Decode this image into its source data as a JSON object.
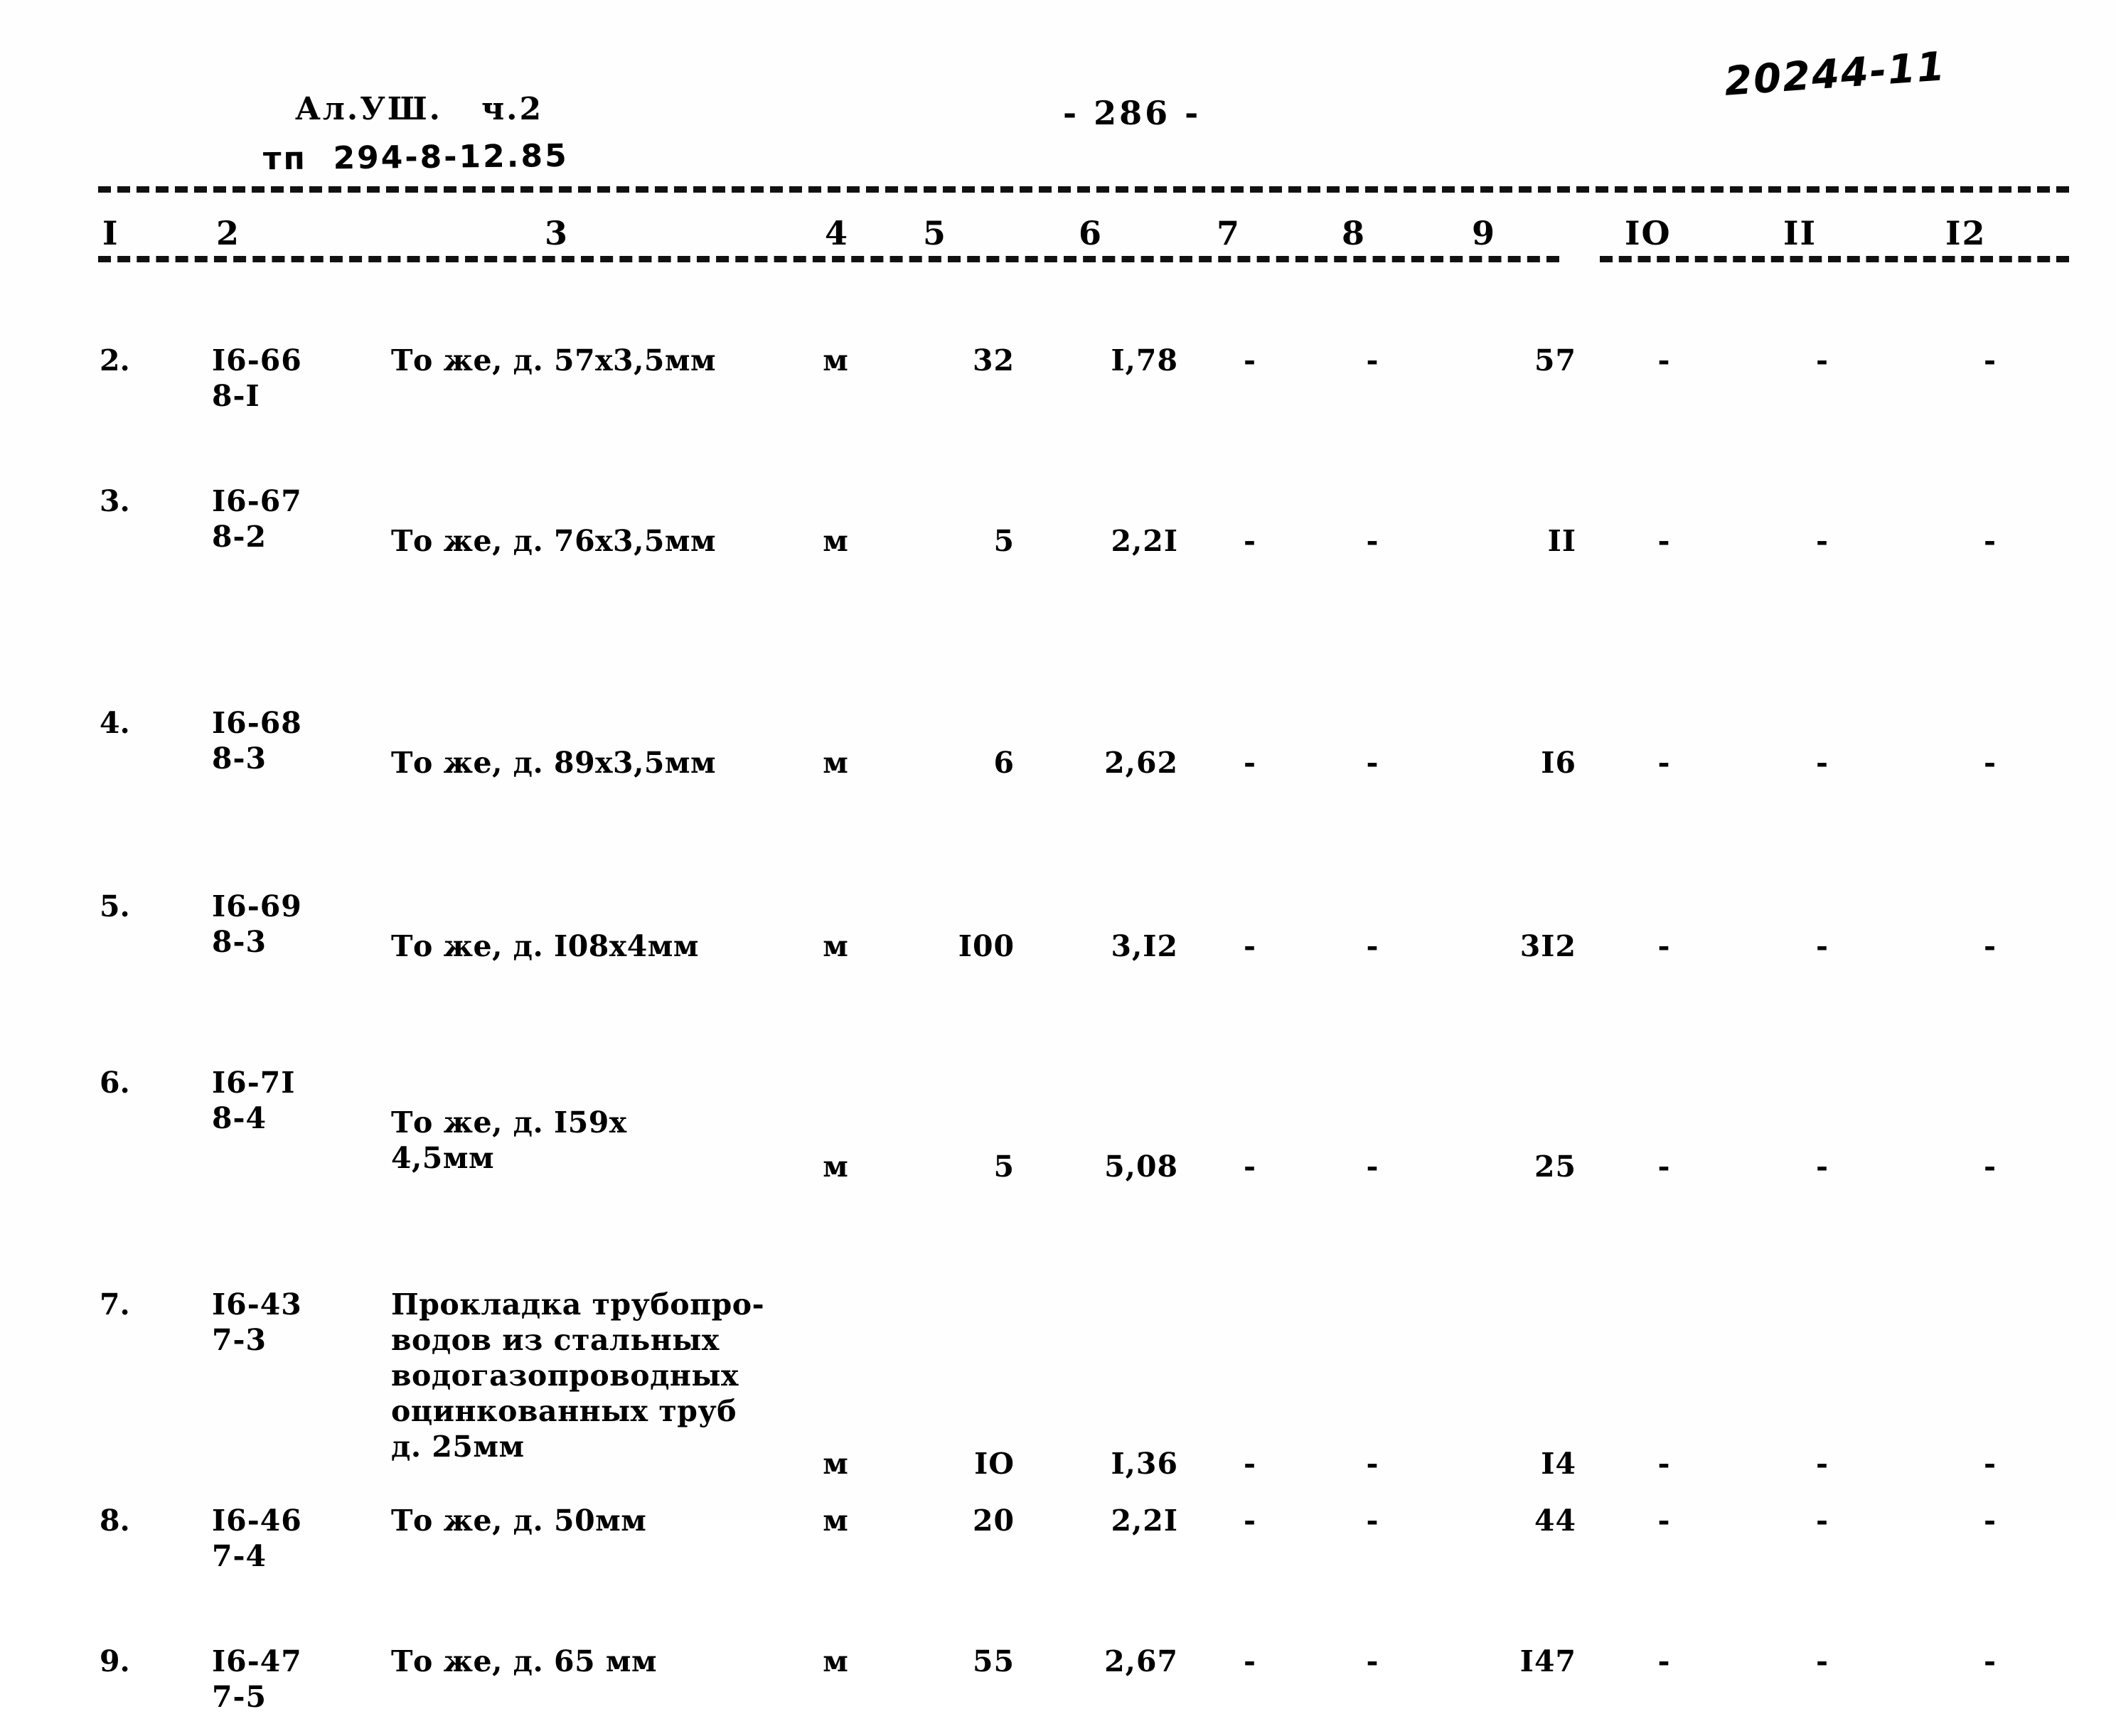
{
  "header": {
    "album_line": "Ал.УШ.   ч.2",
    "tp_line": "тп  294-8-12.85",
    "page_number": "- 286 -",
    "doc_stamp": "20244-11"
  },
  "table": {
    "column_headers": [
      "I",
      "2",
      "3",
      "4",
      "5",
      "6",
      "7",
      "8",
      "9",
      "IO",
      "II",
      "I2"
    ],
    "rows": [
      {
        "no": "2.",
        "code": "I6-66\n8-I",
        "description": "То же, д. 57х3,5мм",
        "unit": "м",
        "qty": "32",
        "price": "I,78",
        "c7": "-",
        "c8": "-",
        "total": "57",
        "c10": "-",
        "c11": "-",
        "c12": "-"
      },
      {
        "no": "3.",
        "code": "I6-67\n8-2",
        "description": "То же, д. 76х3,5мм",
        "unit": "м",
        "qty": "5",
        "price": "2,2I",
        "c7": "-",
        "c8": "-",
        "total": "II",
        "c10": "-",
        "c11": "-",
        "c12": "-"
      },
      {
        "no": "4.",
        "code": "I6-68\n8-3",
        "description": "То же, д. 89х3,5мм",
        "unit": "м",
        "qty": "6",
        "price": "2,62",
        "c7": "-",
        "c8": "-",
        "total": "I6",
        "c10": "-",
        "c11": "-",
        "c12": "-"
      },
      {
        "no": "5.",
        "code": "I6-69\n8-3",
        "description": "То же, д. I08х4мм",
        "unit": "м",
        "qty": "I00",
        "price": "3,I2",
        "c7": "-",
        "c8": "-",
        "total": "3I2",
        "c10": "-",
        "c11": "-",
        "c12": "-"
      },
      {
        "no": "6.",
        "code": "I6-7I\n8-4",
        "description": "То же, д. I59х\n4,5мм",
        "unit": "м",
        "qty": "5",
        "price": "5,08",
        "c7": "-",
        "c8": "-",
        "total": "25",
        "c10": "-",
        "c11": "-",
        "c12": "-"
      },
      {
        "no": "7.",
        "code": "I6-43\n7-3",
        "description": "Прокладка трубопро-\nводов из стальных\nводогазопроводных\nоцинкованных труб\nд. 25мм",
        "unit": "м",
        "qty": "IO",
        "price": "I,36",
        "c7": "-",
        "c8": "-",
        "total": "I4",
        "c10": "-",
        "c11": "-",
        "c12": "-"
      },
      {
        "no": "8.",
        "code": "I6-46\n7-4",
        "description": "То же, д. 50мм",
        "unit": "м",
        "qty": "20",
        "price": "2,2I",
        "c7": "-",
        "c8": "-",
        "total": "44",
        "c10": "-",
        "c11": "-",
        "c12": "-"
      },
      {
        "no": "9.",
        "code": "I6-47\n7-5",
        "description": "То же, д. 65 мм",
        "unit": "м",
        "qty": "55",
        "price": "2,67",
        "c7": "-",
        "c8": "-",
        "total": "I47",
        "c10": "-",
        "c11": "-",
        "c12": "-"
      }
    ]
  }
}
